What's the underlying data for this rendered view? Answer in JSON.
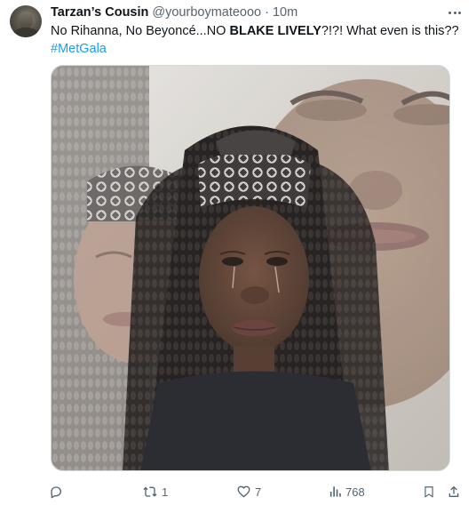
{
  "tweet": {
    "author": {
      "display_name": "Tarzan’s Cousin",
      "handle": "@yourboymateooo",
      "separator": "·",
      "time": "10m"
    },
    "text": {
      "part1": "No Rihanna, No Beyoncé...NO ",
      "bold": "BLAKE LIVELY",
      "part2": "?!?! What even is this??",
      "hashtag": "#MetGala"
    },
    "media": {
      "kind": "photo",
      "subject": "crying woman with braids and bandana headband, double exposure"
    },
    "actions": {
      "reply": {
        "icon": "reply-icon",
        "count": ""
      },
      "retweet": {
        "icon": "retweet-icon",
        "count": "1"
      },
      "like": {
        "icon": "heart-icon",
        "count": "7"
      },
      "views": {
        "icon": "views-icon",
        "count": "768"
      },
      "bookmark": {
        "icon": "bookmark-icon"
      },
      "share": {
        "icon": "share-icon"
      }
    }
  },
  "colors": {
    "text_primary": "#0f1419",
    "text_secondary": "#536471",
    "link": "#1d9bf0",
    "border": "#cfd9de"
  }
}
